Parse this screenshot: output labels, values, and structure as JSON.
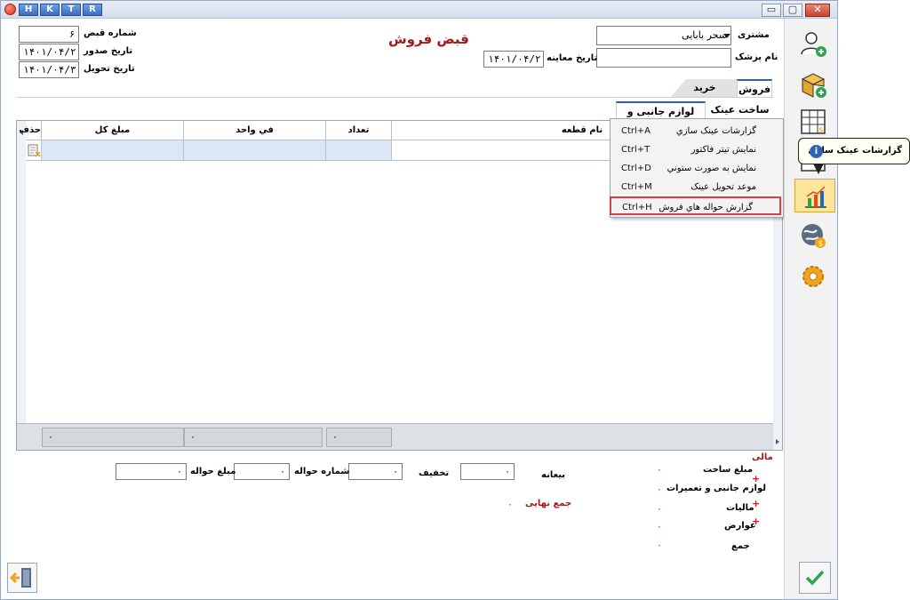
{
  "titlebar": {
    "quick_buttons": [
      "H",
      "K",
      "T",
      "R"
    ],
    "min_label": "▭",
    "restore_label": "▢",
    "close_label": "✕"
  },
  "form": {
    "title": "قبض فروش",
    "receipt_number_label": "شماره قبض",
    "receipt_number_value": "۶",
    "issue_date_label": "تاریخ صدور",
    "issue_date_value": "۱۴۰۱/۰۴/۲۱",
    "delivery_date_label": "تاریخ تحویل",
    "delivery_date_value": "۱۴۰۱/۰۴/۳۱",
    "customer_label": "مشتری",
    "customer_value": "سحر بابایی",
    "doctor_label": "نام پزشک",
    "doctor_value": "",
    "exam_date_label": "تاریخ معاینه",
    "exam_date_value": "۱۴۰۱/۰۴/۲۱"
  },
  "tabs": {
    "sales": "فروش",
    "buy": "خرید",
    "make_glasses": "ساخت عینک",
    "accessories": "لوازم جانبی و تعمیرات"
  },
  "grid": {
    "headers": {
      "part_name": "نام قطعه",
      "count": "تعداد",
      "unit_price": "في واحد",
      "total": "مبلغ کل",
      "delete": "حذف"
    },
    "footer": {
      "total_sum": "۰",
      "unit_sum": "۰",
      "count_sum": "۰"
    }
  },
  "context_menu": [
    {
      "label": "گزارشات عینک سازي",
      "shortcut": "Ctrl+A",
      "highlighted": false
    },
    {
      "label": "نمايش تيتر فاکتور",
      "shortcut": "Ctrl+T",
      "highlighted": false
    },
    {
      "label": "نمايش به صورت ستوني",
      "shortcut": "Ctrl+D",
      "highlighted": false
    },
    {
      "label": "موعد تحويل عينک",
      "shortcut": "Ctrl+M",
      "highlighted": false
    },
    {
      "label": "گزارش حواله هاي فروش",
      "shortcut": "Ctrl+H",
      "highlighted": true
    }
  ],
  "tooltip": {
    "text": "گزارشات عینک سازي"
  },
  "payment": {
    "deposit_label": "بیعانه",
    "deposit_value": "۰",
    "discount_label": "تخفیف",
    "discount_value": "۰",
    "transfer_number_label": "شماره حواله",
    "transfer_number_value": "۰",
    "transfer_amount_label": "مبلغ حواله",
    "transfer_amount_value": "۰",
    "final_total_label": "جمع نهایی",
    "final_total_value": "۰"
  },
  "financial": {
    "heading": "مالی",
    "make_amount_label": "مبلغ ساخت",
    "make_amount_value": "۰",
    "accessories_label": "لوازم جانبی و تعمیرات",
    "accessories_value": "۰",
    "taxes_label": "مالیات",
    "taxes_value": "۰",
    "duties_label": "عوارض",
    "duties_value": "۰",
    "sum_label": "جمع",
    "sum_value": "۰",
    "plus_sign": "+"
  }
}
